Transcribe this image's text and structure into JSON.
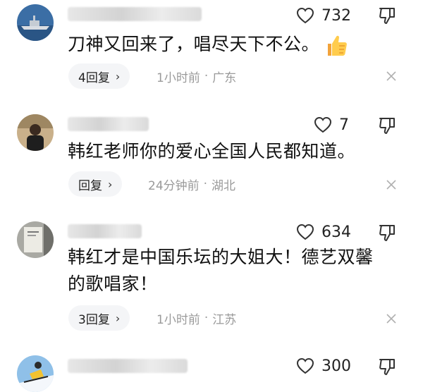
{
  "comments": [
    {
      "likes": "732",
      "text": "刀神又回来了，唱尽天下不公。",
      "reply_label": "4回复",
      "time": "1小时前",
      "sep": "·",
      "location": "广东"
    },
    {
      "likes": "7",
      "text": "韩红老师你的爱心全国人民都知道。",
      "reply_label": "回复",
      "time": "24分钟前",
      "sep": "·",
      "location": "湖北"
    },
    {
      "likes": "634",
      "text": "韩红才是中国乐坛的大姐大！德艺双馨的歌唱家！",
      "reply_label": "3回复",
      "time": "1小时前",
      "sep": "·",
      "location": "江苏"
    },
    {
      "likes": "300"
    }
  ],
  "icons": {
    "like": "heart-outline-icon",
    "dislike": "thumbs-down-outline-icon",
    "close": "close-icon",
    "reply_chevron": "chevron-right-icon",
    "emoji": "thumbs-up-emoji-icon"
  },
  "colors": {
    "text": "#111111",
    "meta": "#9a9a9a",
    "reply_pill": "#f4f5f7"
  },
  "glyphs": {
    "chevron": "›"
  }
}
